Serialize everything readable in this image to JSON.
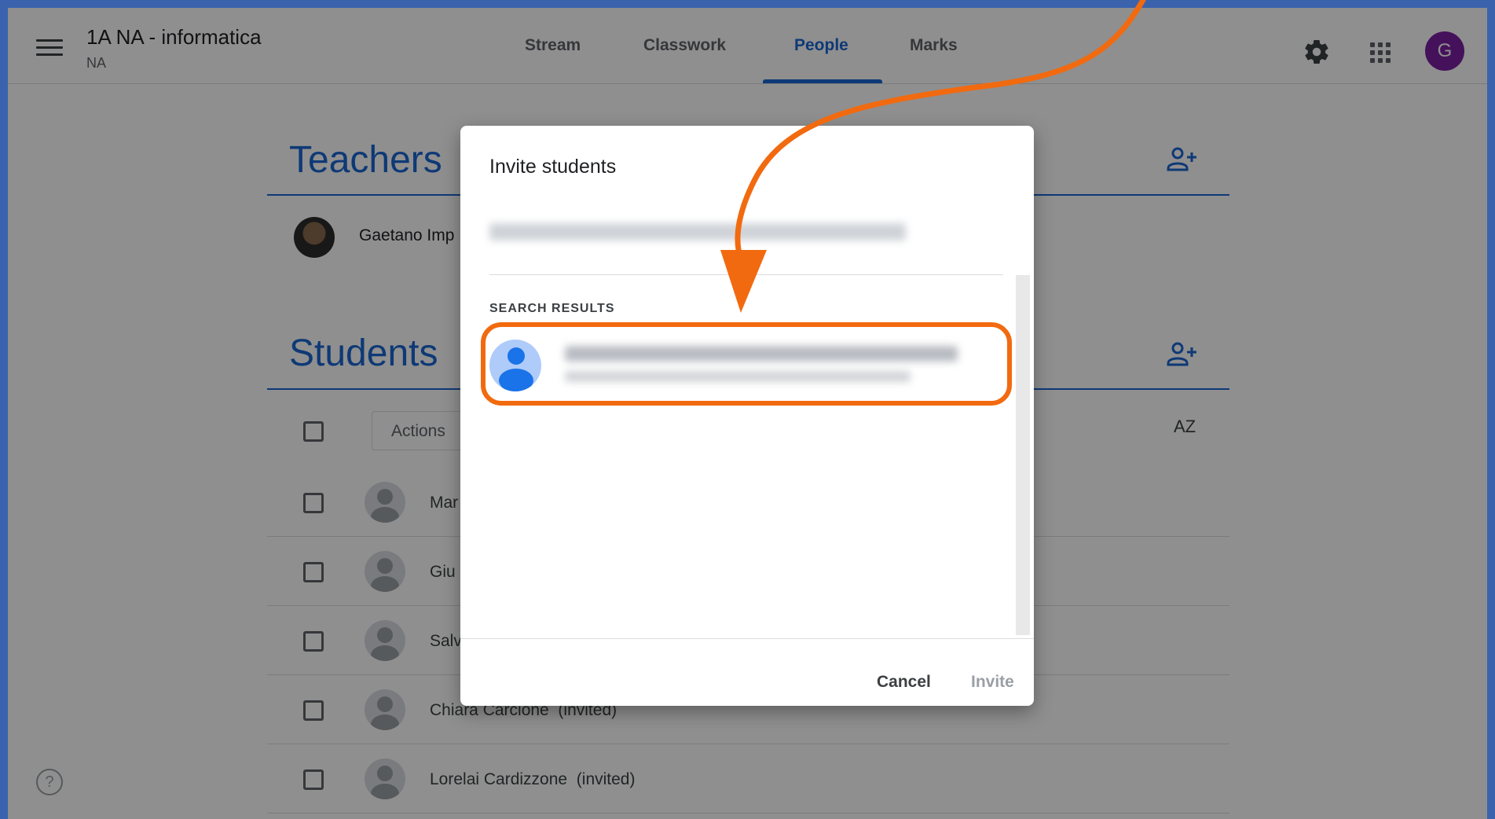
{
  "header": {
    "class_title": "1A NA - informatica",
    "class_subtitle": "NA",
    "tabs": [
      {
        "label": "Stream"
      },
      {
        "label": "Classwork"
      },
      {
        "label": "People"
      },
      {
        "label": "Marks"
      }
    ],
    "active_tab": "People",
    "account_initial": "G"
  },
  "teachers": {
    "title": "Teachers",
    "list": [
      {
        "name": "Gaetano Imp"
      }
    ]
  },
  "students": {
    "title": "Students",
    "actions_label": "Actions",
    "sort_label": "AZ",
    "list": [
      {
        "name": "Mar"
      },
      {
        "name": "Giu"
      },
      {
        "name": "Salv"
      },
      {
        "name": "Chiara Carcione",
        "status": "(invited)"
      },
      {
        "name": "Lorelai Cardizzone",
        "status": "(invited)"
      }
    ]
  },
  "dialog": {
    "title": "Invite students",
    "search_results_label": "SEARCH RESULTS",
    "cancel_label": "Cancel",
    "invite_label": "Invite"
  },
  "help_label": "?",
  "colors": {
    "brand_blue": "#1967d2",
    "highlight_orange": "#f26a0f",
    "account_purple": "#7b1fa2",
    "frame_blue": "#3a62ad"
  }
}
